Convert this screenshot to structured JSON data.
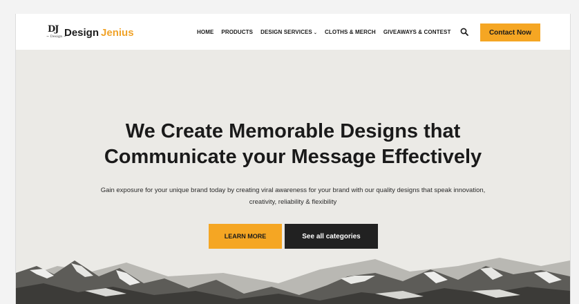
{
  "brand": {
    "monogram": "DJ",
    "tagline": "~ Design ~",
    "name_part1": "Design",
    "name_part2": "Jenius",
    "accent_color": "#f5a623"
  },
  "nav": {
    "items": [
      {
        "label": "HOME"
      },
      {
        "label": "PRODUCTS"
      },
      {
        "label": "DESIGN SERVICES",
        "has_dropdown": true
      },
      {
        "label": "CLOTHS & MERCH"
      },
      {
        "label": "GIVEAWAYS & CONTEST"
      }
    ],
    "dropdown_caret": "⌄",
    "search_icon": "search-icon",
    "contact_label": "Contact Now"
  },
  "hero": {
    "title_line1": "We Create Memorable Designs that",
    "title_line2": "Communicate your Message Effectively",
    "subtitle_line1": "Gain exposure for your unique brand today by creating viral awareness for your brand with our quality designs that speak innovation,",
    "subtitle_line2": "creativity, reliability & flexibility",
    "learn_more_label": "LEARN MORE",
    "categories_label": "See all categories",
    "background_image": "snowy-mountains"
  }
}
